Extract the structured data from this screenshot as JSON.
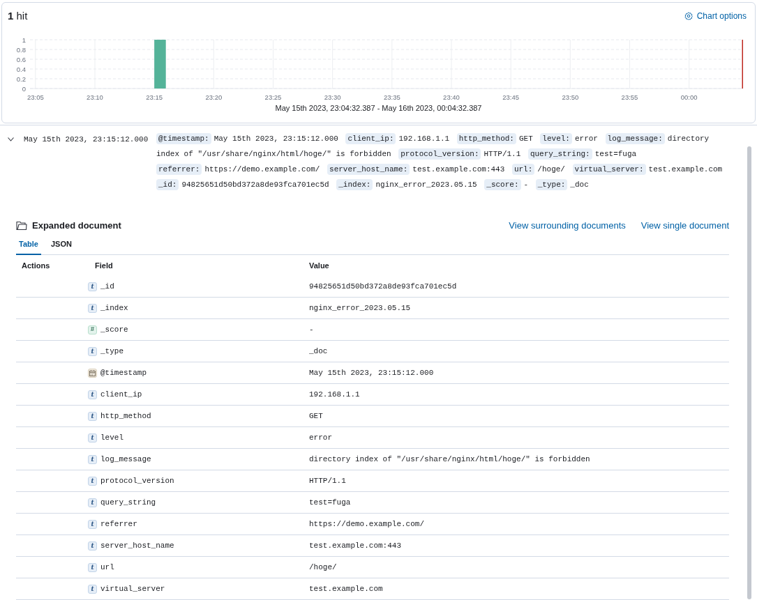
{
  "hits": {
    "count": "1",
    "label": "hit"
  },
  "chart_options": {
    "label": "Chart options"
  },
  "chart_data": {
    "type": "bar",
    "grid": true,
    "x": [
      "23:05",
      "23:10",
      "23:15",
      "23:20",
      "23:25",
      "23:30",
      "23:35",
      "23:40",
      "23:45",
      "23:50",
      "23:55",
      "00:00"
    ],
    "series": [
      {
        "color": "#54b399",
        "values": [
          0,
          0,
          1,
          0,
          0,
          0,
          0,
          0,
          0,
          0,
          0,
          0
        ]
      }
    ],
    "ylim": [
      0,
      1
    ],
    "yticks": [
      {
        "value": 0,
        "label": "0"
      },
      {
        "value": 0.2,
        "label": "0.2"
      },
      {
        "value": 0.4,
        "label": "0.4"
      },
      {
        "value": 0.6,
        "label": "0.6"
      },
      {
        "value": 0.8,
        "label": "0.8"
      },
      {
        "value": 1,
        "label": "1"
      }
    ]
  },
  "time_range": "May 15th 2023, 23:04:32.387 - May 16th 2023, 00:04:32.387",
  "document": {
    "expanded": true,
    "timestamp": "May 15th 2023, 23:15:12.000",
    "summary": [
      {
        "key": "@timestamp:",
        "value": "May 15th 2023, 23:15:12.000"
      },
      {
        "key": "client_ip:",
        "value": "192.168.1.1"
      },
      {
        "key": "http_method:",
        "value": "GET"
      },
      {
        "key": "level:",
        "value": "error"
      },
      {
        "key": "log_message:",
        "value": "directory index of \"/usr/share/nginx/html/hoge/\" is forbidden"
      },
      {
        "key": "protocol_version:",
        "value": "HTTP/1.1"
      },
      {
        "key": "query_string:",
        "value": "test=fuga"
      },
      {
        "key": "referrer:",
        "value": "https://demo.example.com/"
      },
      {
        "key": "server_host_name:",
        "value": "test.example.com:443"
      },
      {
        "key": "url:",
        "value": "/hoge/"
      },
      {
        "key": "virtual_server:",
        "value": "test.example.com"
      },
      {
        "key": "_id:",
        "value": "94825651d50bd372a8de93fca701ec5d"
      },
      {
        "key": "_index:",
        "value": "nginx_error_2023.05.15"
      },
      {
        "key": "_score:",
        "value": "-"
      },
      {
        "key": "_type:",
        "value": "_doc"
      }
    ]
  },
  "expanded_document": {
    "title": "Expanded document",
    "links": [
      "View surrounding documents",
      "View single document"
    ],
    "tabs": [
      {
        "label": "Table",
        "selected": true
      },
      {
        "label": "JSON",
        "selected": false
      }
    ],
    "columns": [
      "Actions",
      "Field",
      "Value"
    ],
    "rows": [
      {
        "kind": "string",
        "badge": "t",
        "field": "_id",
        "value": "94825651d50bd372a8de93fca701ec5d"
      },
      {
        "kind": "string",
        "badge": "t",
        "field": "_index",
        "value": "nginx_error_2023.05.15"
      },
      {
        "kind": "number",
        "badge": "#",
        "field": "_score",
        "value": "-"
      },
      {
        "kind": "string",
        "badge": "t",
        "field": "_type",
        "value": "_doc"
      },
      {
        "kind": "date",
        "field": "@timestamp",
        "value": "May 15th 2023, 23:15:12.000"
      },
      {
        "kind": "string",
        "badge": "t",
        "field": "client_ip",
        "value": "192.168.1.1"
      },
      {
        "kind": "string",
        "badge": "t",
        "field": "http_method",
        "value": "GET"
      },
      {
        "kind": "string",
        "badge": "t",
        "field": "level",
        "value": "error"
      },
      {
        "kind": "string",
        "badge": "t",
        "field": "log_message",
        "value": "directory index of \"/usr/share/nginx/html/hoge/\" is forbidden"
      },
      {
        "kind": "string",
        "badge": "t",
        "field": "protocol_version",
        "value": "HTTP/1.1"
      },
      {
        "kind": "string",
        "badge": "t",
        "field": "query_string",
        "value": "test=fuga"
      },
      {
        "kind": "string",
        "badge": "t",
        "field": "referrer",
        "value": "https://demo.example.com/"
      },
      {
        "kind": "string",
        "badge": "t",
        "field": "server_host_name",
        "value": "test.example.com:443"
      },
      {
        "kind": "string",
        "badge": "t",
        "field": "url",
        "value": "/hoge/"
      },
      {
        "kind": "string",
        "badge": "t",
        "field": "virtual_server",
        "value": "test.example.com"
      }
    ]
  }
}
